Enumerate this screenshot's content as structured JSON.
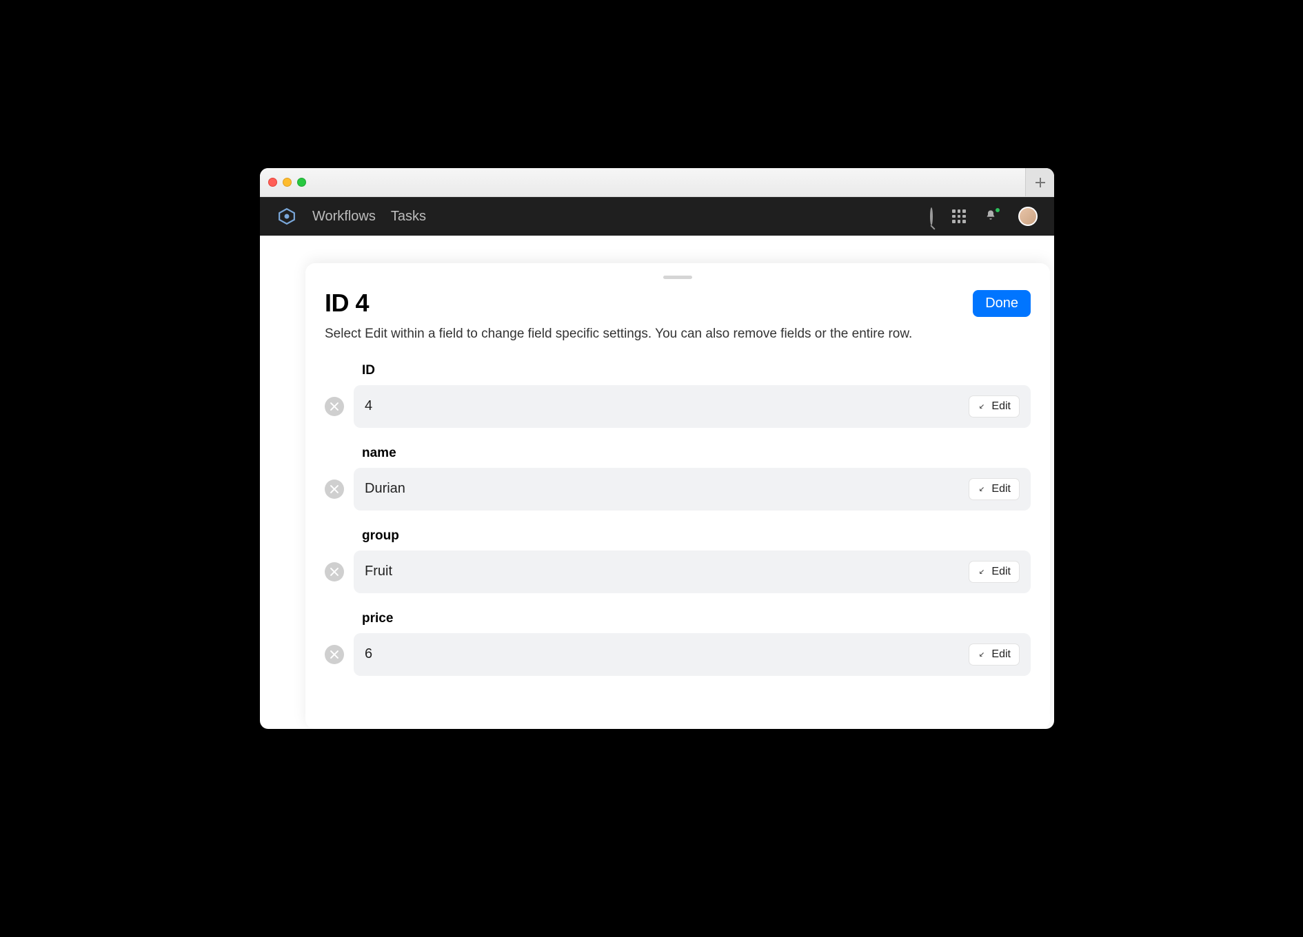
{
  "header": {
    "nav": [
      "Workflows",
      "Tasks"
    ]
  },
  "sheet": {
    "title": "ID 4",
    "description": "Select Edit within a field to change field specific settings. You can also remove fields or the entire row.",
    "done_label": "Done",
    "edit_label": "Edit",
    "fields": [
      {
        "label": "ID",
        "value": "4"
      },
      {
        "label": "name",
        "value": "Durian"
      },
      {
        "label": "group",
        "value": "Fruit"
      },
      {
        "label": "price",
        "value": "6"
      }
    ]
  }
}
